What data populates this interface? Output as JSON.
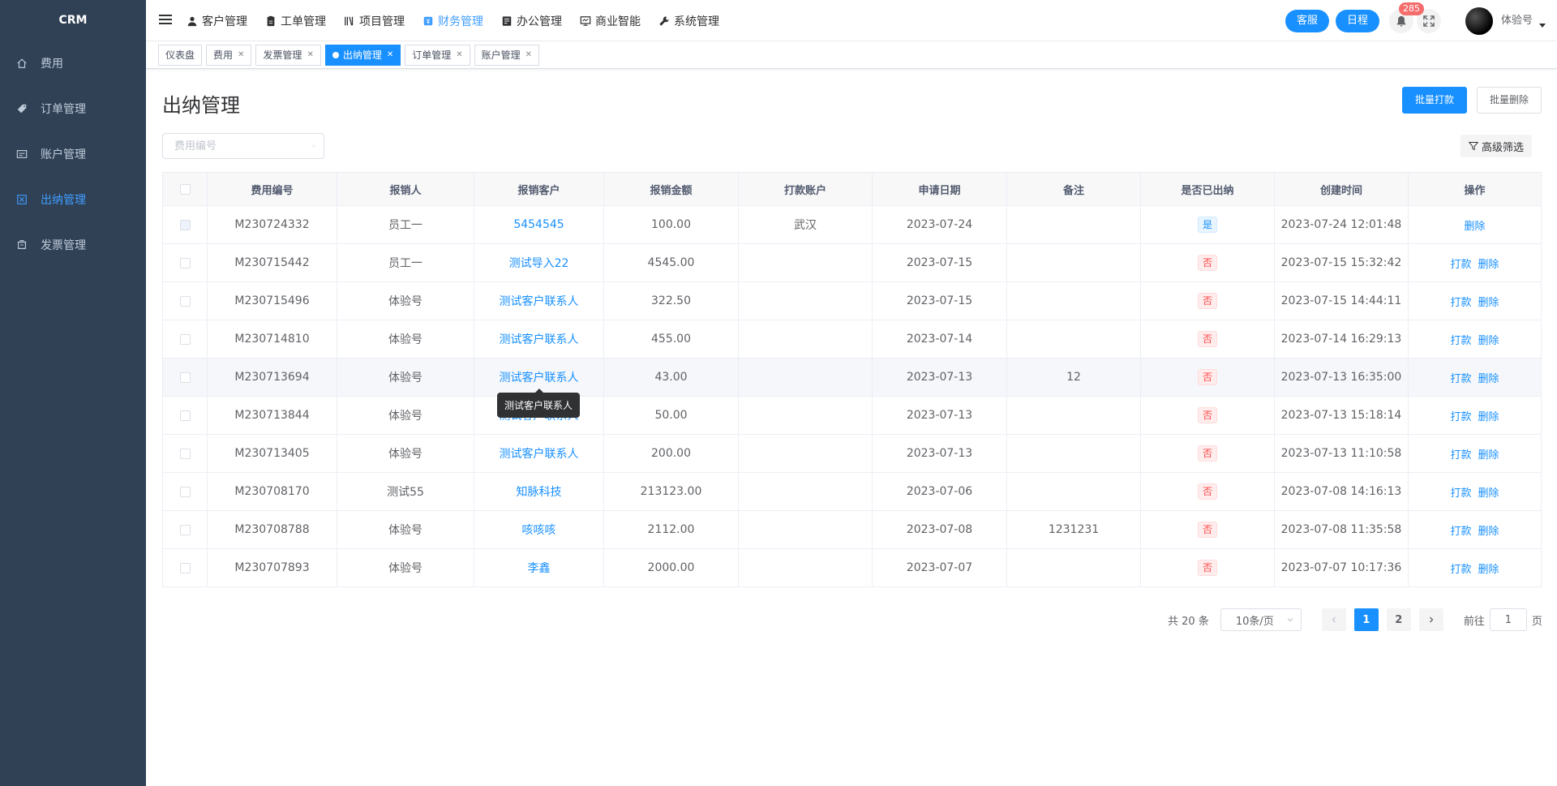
{
  "sidebar": {
    "logo": "CRM",
    "items": [
      {
        "label": "费用",
        "icon": "home-icon",
        "active": false
      },
      {
        "label": "订单管理",
        "icon": "tag-icon",
        "active": false
      },
      {
        "label": "账户管理",
        "icon": "card-icon",
        "active": false
      },
      {
        "label": "出纳管理",
        "icon": "cashier-icon",
        "active": true
      },
      {
        "label": "发票管理",
        "icon": "invoice-icon",
        "active": false
      }
    ]
  },
  "topnav": {
    "menus": [
      {
        "label": "客户管理",
        "icon": "user-icon",
        "active": false
      },
      {
        "label": "工单管理",
        "icon": "ticket-icon",
        "active": false
      },
      {
        "label": "项目管理",
        "icon": "book-icon",
        "active": false
      },
      {
        "label": "财务管理",
        "icon": "finance-icon",
        "active": true
      },
      {
        "label": "办公管理",
        "icon": "office-icon",
        "active": false
      },
      {
        "label": "商业智能",
        "icon": "monitor-icon",
        "active": false
      },
      {
        "label": "系统管理",
        "icon": "wrench-icon",
        "active": false
      }
    ],
    "service_label": "客服",
    "schedule_label": "日程",
    "notification_count": "285",
    "username": "体验号"
  },
  "tags": [
    {
      "label": "仪表盘",
      "closable": false,
      "active": false
    },
    {
      "label": "费用",
      "closable": true,
      "active": false
    },
    {
      "label": "发票管理",
      "closable": true,
      "active": false
    },
    {
      "label": "出纳管理",
      "closable": true,
      "active": true
    },
    {
      "label": "订单管理",
      "closable": true,
      "active": false
    },
    {
      "label": "账户管理",
      "closable": true,
      "active": false
    }
  ],
  "page": {
    "title": "出纳管理",
    "batch_pay_label": "批量打款",
    "batch_delete_label": "批量删除",
    "search_placeholder": "费用编号",
    "advanced_filter_label": "高级筛选"
  },
  "table": {
    "columns": [
      "费用编号",
      "报销人",
      "报销客户",
      "报销金额",
      "打款账户",
      "申请日期",
      "备注",
      "是否已出纳",
      "创建时间",
      "操作"
    ],
    "rows": [
      {
        "code": "M230724332",
        "person": "员工一",
        "customer": "5454545",
        "amount": "100.00",
        "account": "武汉",
        "date": "2023-07-24",
        "note": "",
        "paid": "是",
        "created": "2023-07-24 12:01:48",
        "ops": [
          "删除"
        ]
      },
      {
        "code": "M230715442",
        "person": "员工一",
        "customer": "测试导入22",
        "amount": "4545.00",
        "account": "",
        "date": "2023-07-15",
        "note": "",
        "paid": "否",
        "created": "2023-07-15 15:32:42",
        "ops": [
          "打款",
          "删除"
        ]
      },
      {
        "code": "M230715496",
        "person": "体验号",
        "customer": "测试客户联系人",
        "amount": "322.50",
        "account": "",
        "date": "2023-07-15",
        "note": "",
        "paid": "否",
        "created": "2023-07-15 14:44:11",
        "ops": [
          "打款",
          "删除"
        ]
      },
      {
        "code": "M230714810",
        "person": "体验号",
        "customer": "测试客户联系人",
        "amount": "455.00",
        "account": "",
        "date": "2023-07-14",
        "note": "",
        "paid": "否",
        "created": "2023-07-14 16:29:13",
        "ops": [
          "打款",
          "删除"
        ]
      },
      {
        "code": "M230713694",
        "person": "体验号",
        "customer": "测试客户联系人",
        "amount": "43.00",
        "account": "",
        "date": "2023-07-13",
        "note": "12",
        "paid": "否",
        "created": "2023-07-13 16:35:00",
        "ops": [
          "打款",
          "删除"
        ]
      },
      {
        "code": "M230713844",
        "person": "体验号",
        "customer": "测试客户联系人",
        "amount": "50.00",
        "account": "",
        "date": "2023-07-13",
        "note": "",
        "paid": "否",
        "created": "2023-07-13 15:18:14",
        "ops": [
          "打款",
          "删除"
        ]
      },
      {
        "code": "M230713405",
        "person": "体验号",
        "customer": "测试客户联系人",
        "amount": "200.00",
        "account": "",
        "date": "2023-07-13",
        "note": "",
        "paid": "否",
        "created": "2023-07-13 11:10:58",
        "ops": [
          "打款",
          "删除"
        ]
      },
      {
        "code": "M230708170",
        "person": "测试55",
        "customer": "知脉科技",
        "amount": "213123.00",
        "account": "",
        "date": "2023-07-06",
        "note": "",
        "paid": "否",
        "created": "2023-07-08 14:16:13",
        "ops": [
          "打款",
          "删除"
        ]
      },
      {
        "code": "M230708788",
        "person": "体验号",
        "customer": "咳咳咳",
        "amount": "2112.00",
        "account": "",
        "date": "2023-07-08",
        "note": "1231231",
        "paid": "否",
        "created": "2023-07-08 11:35:58",
        "ops": [
          "打款",
          "删除"
        ]
      },
      {
        "code": "M230707893",
        "person": "体验号",
        "customer": "李鑫",
        "amount": "2000.00",
        "account": "",
        "date": "2023-07-07",
        "note": "",
        "paid": "否",
        "created": "2023-07-07 10:17:36",
        "ops": [
          "打款",
          "删除"
        ]
      }
    ]
  },
  "tooltip": "测试客户联系人",
  "pagination": {
    "total_label": "共 20 条",
    "page_size_label": "10条/页",
    "pages": [
      "1",
      "2"
    ],
    "current_page": "1",
    "goto_label": "前往",
    "goto_value": "1",
    "page_suffix": "页"
  },
  "colors": {
    "accent": "#1890ff",
    "sidebar_bg": "#304156",
    "danger": "#ff4949"
  }
}
